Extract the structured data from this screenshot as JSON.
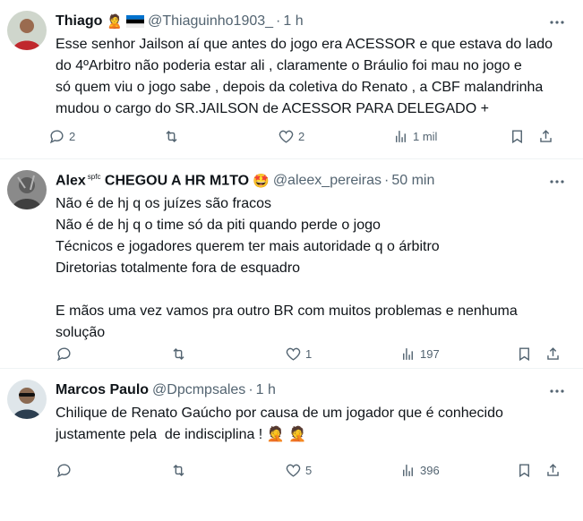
{
  "tweets": [
    {
      "name": "Thiago",
      "name_sup": "",
      "name_suffix": "",
      "handle": "@Thiaguinho1903_",
      "time": "1 h",
      "text": "Esse senhor Jailson aí que antes do jogo era ACESSOR e que estava do lado\ndo 4ºArbitro não poderia estar ali , claramente o Bráulio foi mau no jogo e\nsó quem viu o jogo sabe , depois da coletiva do Renato , a CBF malandrinha\nmudou o cargo do SR.JAILSON de ACESSOR PARA DELEGADO +",
      "replies": "2",
      "retweets": "",
      "likes": "2",
      "views": "1 mil"
    },
    {
      "name": "Alex",
      "name_sup": "spfc",
      "name_suffix": "CHEGOU A HR M1TO",
      "handle": "@aleex_pereiras",
      "time": "50 min",
      "text": "Não é de hj q os juízes são fracos\nNão é de hj q o time só da piti quando perde o jogo\nTécnicos e jogadores querem ter mais autoridade q o árbitro\nDiretorias totalmente fora de esquadro\n\nE mãos uma vez vamos pra outro BR com muitos problemas e nenhuma\nsolução",
      "replies": "",
      "retweets": "",
      "likes": "1",
      "views": "197"
    },
    {
      "name": "Marcos Paulo",
      "name_sup": "",
      "name_suffix": "",
      "handle": "@Dpcmpsales",
      "time": "1 h",
      "text": "Chilique de Renato Gaúcho por causa de um jogador que é conhecido\njustamente pela  de indisciplina ! ",
      "replies": "",
      "retweets": "",
      "likes": "5",
      "views": "396"
    }
  ],
  "colors": {
    "text": "#0f1419",
    "muted": "#536471",
    "divider": "#eff3f4"
  },
  "icons": [
    "reply-icon",
    "retweet-icon",
    "like-icon",
    "views-icon",
    "bookmark-icon",
    "share-icon",
    "more-icon"
  ]
}
